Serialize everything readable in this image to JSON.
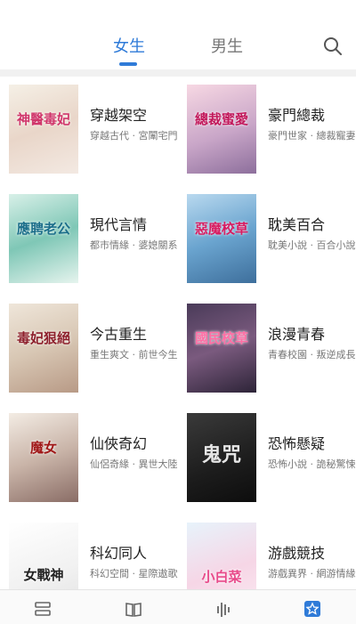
{
  "tabs": {
    "female": "女生",
    "male": "男生"
  },
  "accent": "#2f7bd8",
  "icons": {
    "search": "search-icon"
  },
  "categories": [
    {
      "title": "穿越架空",
      "subtitle": "穿越古代 · 宮闈宅門",
      "cover_text": "神醫毒妃"
    },
    {
      "title": "豪門總裁",
      "subtitle": "豪門世家 · 總裁寵妻",
      "cover_text": "總裁蜜愛"
    },
    {
      "title": "現代言情",
      "subtitle": "都市情緣 · 婆媳關系",
      "cover_text": "應聘老公"
    },
    {
      "title": "耽美百合",
      "subtitle": "耽美小說 · 百合小說",
      "cover_text": "惡魔校草"
    },
    {
      "title": "今古重生",
      "subtitle": "重生爽文 · 前世今生",
      "cover_text": "毒妃狠絕"
    },
    {
      "title": "浪漫青春",
      "subtitle": "青春校園 · 叛逆成長",
      "cover_text": "國民校草"
    },
    {
      "title": "仙俠奇幻",
      "subtitle": "仙侶奇緣 · 異世大陸",
      "cover_text": "魔女"
    },
    {
      "title": "恐怖懸疑",
      "subtitle": "恐怖小說 · 詭秘驚悚",
      "cover_text": "鬼咒"
    },
    {
      "title": "科幻同人",
      "subtitle": "科幻空間 · 星際遨歌",
      "cover_text": "女戰神"
    },
    {
      "title": "游戲競技",
      "subtitle": "游戲異界 · 網游情緣",
      "cover_text": "小白菜"
    }
  ],
  "bottom_nav": [
    "bookshelf-icon",
    "book-icon",
    "ranking-icon",
    "category-icon"
  ]
}
